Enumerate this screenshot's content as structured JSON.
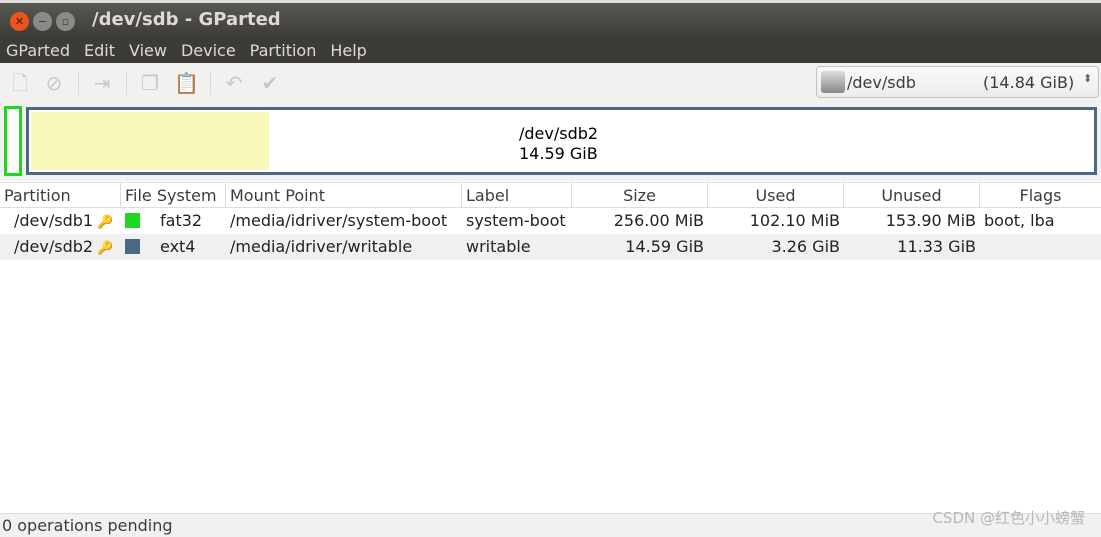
{
  "window": {
    "title": "/dev/sdb - GParted"
  },
  "menu": [
    "GParted",
    "Edit",
    "View",
    "Device",
    "Partition",
    "Help"
  ],
  "toolbar": {
    "icons": [
      "new-icon",
      "delete-icon",
      "resize-move-icon",
      "copy-icon",
      "paste-icon",
      "undo-icon",
      "apply-icon"
    ]
  },
  "device": {
    "name": "/dev/sdb",
    "size": "(14.84 GiB)"
  },
  "map": {
    "selected": "/dev/sdb2",
    "selected_size": "14.59 GiB",
    "selected_used_fraction": 0.224,
    "colors": {
      "fat32": "#1ed71e",
      "ext4": "#4b6983",
      "used": "#f8f8ba"
    }
  },
  "table": {
    "headers": [
      "Partition",
      "File System",
      "Mount Point",
      "Label",
      "Size",
      "Used",
      "Unused",
      "Flags"
    ],
    "rows": [
      {
        "partition": "/dev/sdb1",
        "fs": "fat32",
        "fs_color": "#1ed71e",
        "mount": "/media/idriver/system-boot",
        "label": "system-boot",
        "size": "256.00 MiB",
        "used": "102.10 MiB",
        "unused": "153.90 MiB",
        "flags": "boot, lba"
      },
      {
        "partition": "/dev/sdb2",
        "fs": "ext4",
        "fs_color": "#4b6983",
        "mount": "/media/idriver/writable",
        "label": "writable",
        "size": "14.59 GiB",
        "used": "3.26 GiB",
        "unused": "11.33 GiB",
        "flags": ""
      }
    ]
  },
  "status": "0 operations pending",
  "watermark": "CSDN @红色小小螃蟹"
}
